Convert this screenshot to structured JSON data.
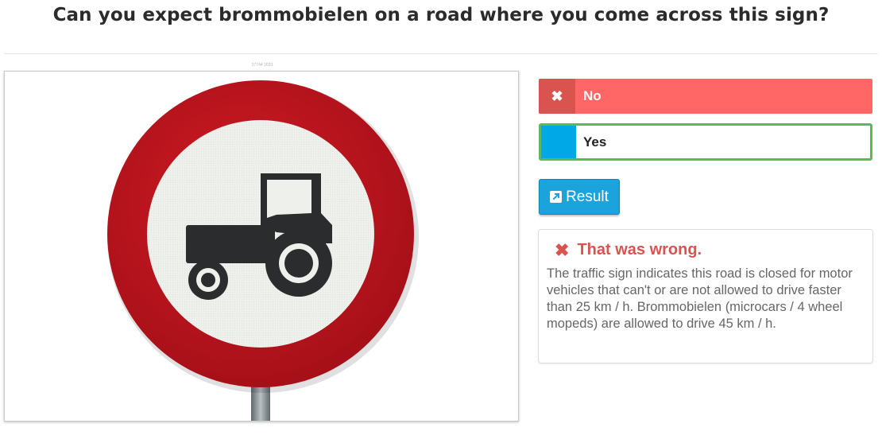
{
  "question": {
    "text": "Can you expect brommobielen on a road where you come across this sign?"
  },
  "image": {
    "caption": "27744 3033",
    "sign": "closed-for-slow-motor-vehicles-sign",
    "colors": {
      "ring": "#b5121b",
      "face": "#eef0ec",
      "symbol": "#2a2c2d",
      "pole": "#8e979b"
    }
  },
  "answers": [
    {
      "label": "No",
      "icon": "close-icon",
      "state": "wrong-selected",
      "color": "#ff6666",
      "icon_bg": "#d9534f"
    },
    {
      "label": "Yes",
      "icon": "",
      "state": "correct",
      "border_color": "#5cb85c",
      "icon_bg": "#00a8e8"
    }
  ],
  "result_button": {
    "label": "Result",
    "icon": "external-link-icon",
    "color": "#1aa3dc"
  },
  "feedback": {
    "title": "That was wrong.",
    "icon": "close-icon",
    "title_color": "#d9534f",
    "text": "The traffic sign indicates this road is closed for motor vehicles that can't or are not allowed to drive faster than 25 km / h. Brommobielen (microcars / 4 wheel mopeds) are allowed to drive 45 km / h."
  }
}
